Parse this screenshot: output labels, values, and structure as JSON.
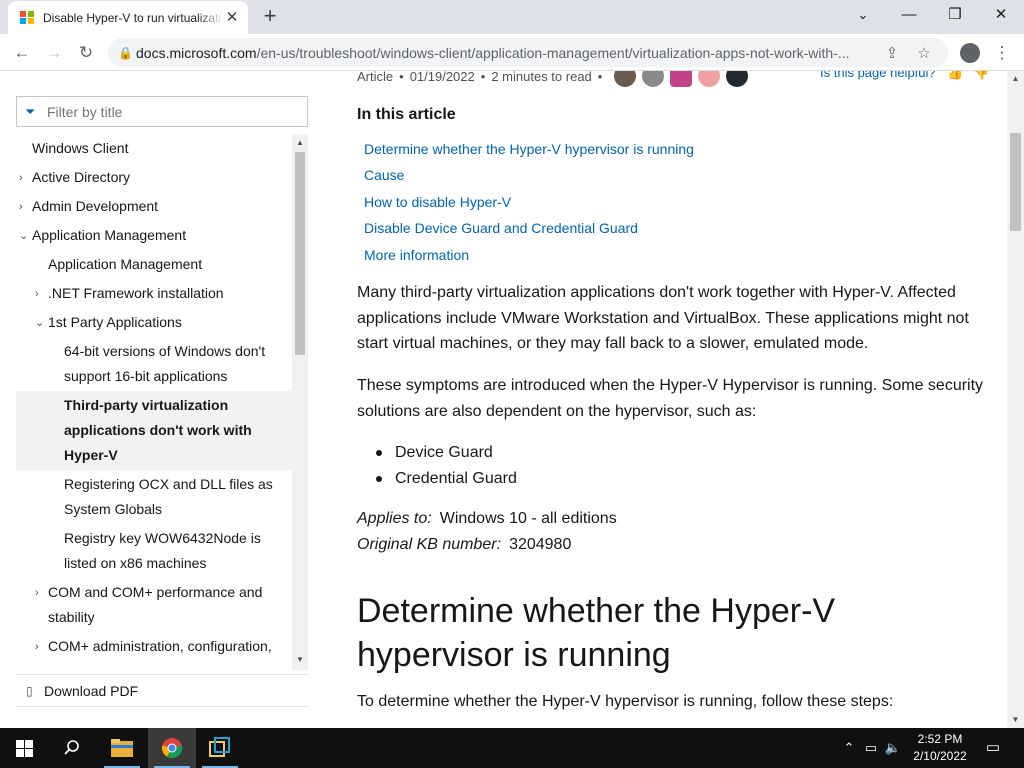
{
  "browser": {
    "tab_title": "Disable Hyper-V to run virtualization software",
    "new_tab": "+",
    "close": "✕",
    "url_domain": "docs.microsoft.com",
    "url_path": "/en-us/troubleshoot/windows-client/application-management/virtualization-apps-not-work-with-...",
    "window_minimize": "—",
    "window_restore": "❐",
    "window_close": "✕",
    "back": "←",
    "forward": "→",
    "reload": "↻",
    "share": "⇪",
    "bookmark": "☆",
    "profile": "●",
    "menu": "⋮",
    "colors": {
      "favicon_red": "#f25022",
      "favicon_green": "#7fba00",
      "favicon_blue": "#00a4ef",
      "favicon_yellow": "#ffb900"
    }
  },
  "sidebar": {
    "filter_placeholder": "Filter by title",
    "download_pdf": "Download PDF",
    "toc": [
      {
        "label": "Windows Client",
        "level": 0,
        "expander": ""
      },
      {
        "label": "Active Directory",
        "level": 0,
        "expander": "›"
      },
      {
        "label": "Admin Development",
        "level": 0,
        "expander": "›"
      },
      {
        "label": "Application Management",
        "level": 0,
        "expander": "⌄"
      },
      {
        "label": "Application Management",
        "level": 1,
        "expander": ""
      },
      {
        "label": ".NET Framework installation",
        "level": 1,
        "expander": "›"
      },
      {
        "label": "1st Party Applications",
        "level": 1,
        "expander": "⌄"
      },
      {
        "label": "64-bit versions of Windows don't support 16-bit applications",
        "level": 2,
        "expander": ""
      },
      {
        "label": "Third-party virtualization applications don't work with Hyper-V",
        "level": 2,
        "expander": "",
        "selected": true
      },
      {
        "label": "Registering OCX and DLL files as System Globals",
        "level": 2,
        "expander": ""
      },
      {
        "label": "Registry key WOW6432Node is listed on x86 machines",
        "level": 2,
        "expander": ""
      },
      {
        "label": "COM and COM+ performance and stability",
        "level": 1,
        "expander": "›"
      },
      {
        "label": "COM+ administration, configuration,",
        "level": 1,
        "expander": "›"
      }
    ]
  },
  "article": {
    "meta_type": "Article",
    "meta_date": "01/19/2022",
    "meta_read": "2 minutes to read",
    "helpful": "Is this page helpful?",
    "in_this_article": "In this article",
    "toc_links": [
      "Determine whether the Hyper-V hypervisor is running",
      "Cause",
      "How to disable Hyper-V",
      "Disable Device Guard and Credential Guard",
      "More information"
    ],
    "para1": "Many third-party virtualization applications don't work together with Hyper-V. Affected applications include VMware Workstation and VirtualBox. These applications might not start virtual machines, or they may fall back to a slower, emulated mode.",
    "para2": "These symptoms are introduced when the Hyper-V Hypervisor is running. Some security solutions are also dependent on the hypervisor, such as:",
    "bullets": [
      "Device Guard",
      "Credential Guard"
    ],
    "applies_label": "Applies to:",
    "applies_value": "Windows 10 - all editions",
    "kb_label": "Original KB number:",
    "kb_value": "3204980",
    "heading": "Determine whether the Hyper-V hypervisor is running",
    "steps_intro": "To determine whether the Hyper-V hypervisor is running, follow these steps:",
    "colors": {
      "link": "#0065b3",
      "text": "#171717"
    }
  },
  "taskbar": {
    "time": "2:52 PM",
    "date": "2/10/2022",
    "apps": [
      "start-icon",
      "search-icon",
      "file-explorer-icon",
      "chrome-icon",
      "vm-app-icon"
    ]
  }
}
